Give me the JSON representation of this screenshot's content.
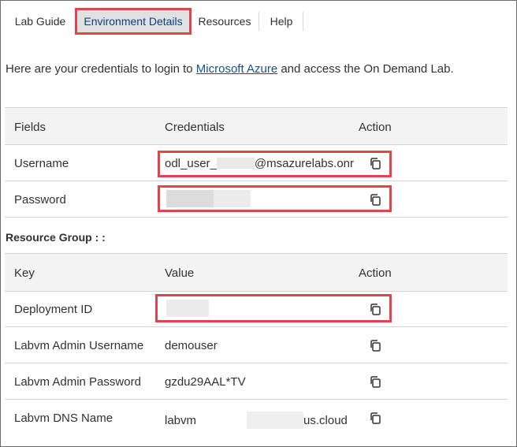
{
  "tabs": [
    {
      "label": "Lab Guide"
    },
    {
      "label": "Environment Details"
    },
    {
      "label": "Resources"
    },
    {
      "label": "Help"
    }
  ],
  "intro": {
    "before": "Here are your credentials to login to ",
    "link": "Microsoft Azure",
    "after": " and access the On Demand Lab."
  },
  "credentials_table": {
    "headers": [
      "Fields",
      "Credentials",
      "Action"
    ],
    "rows": [
      {
        "field": "Username",
        "prefix": "odl_user_",
        "suffix": "@msazurelabs.onr"
      },
      {
        "field": "Password"
      }
    ]
  },
  "resource_group": {
    "label": "Resource Group : :"
  },
  "resource_table": {
    "headers": [
      "Key",
      "Value",
      "Action"
    ],
    "rows": [
      {
        "key": "Deployment ID",
        "value": ""
      },
      {
        "key": "Labvm Admin Username",
        "value": "demouser"
      },
      {
        "key": "Labvm Admin Password",
        "value": "gzdu29AAL*TV"
      },
      {
        "key": "Labvm DNS Name",
        "prefix": "labvm",
        "suffix": "us.cloud"
      }
    ]
  },
  "icons": {
    "copy": "copy-icon"
  },
  "colors": {
    "highlight": "#e2444b",
    "link": "#1a4f8f",
    "active_tab_bg": "#e1e1e1",
    "header_bg": "#f3f3f3"
  }
}
